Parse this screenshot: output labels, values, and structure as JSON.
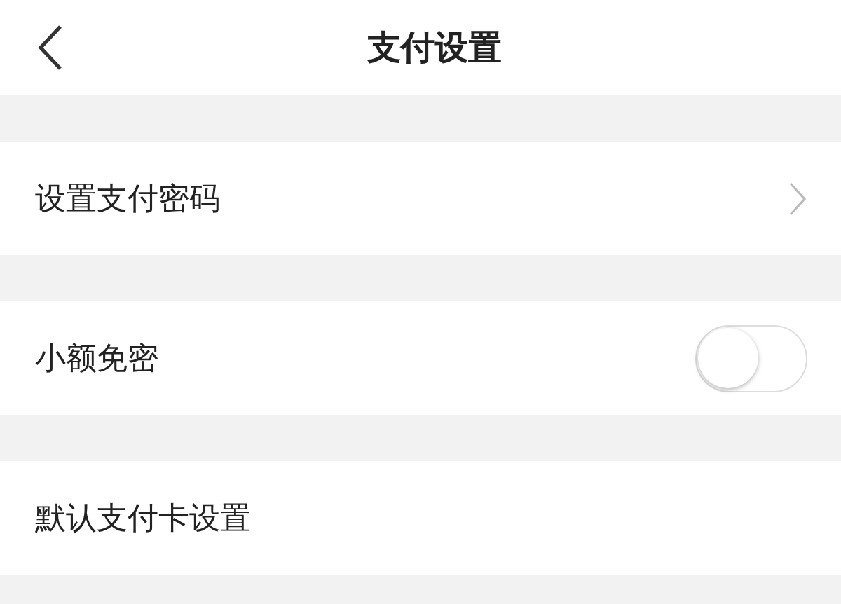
{
  "header": {
    "title": "支付设置"
  },
  "rows": [
    {
      "kind": "link",
      "label": "设置支付密码"
    },
    {
      "kind": "toggle",
      "label": "小额免密",
      "on": false
    },
    {
      "kind": "plain",
      "label": "默认支付卡设置"
    }
  ]
}
